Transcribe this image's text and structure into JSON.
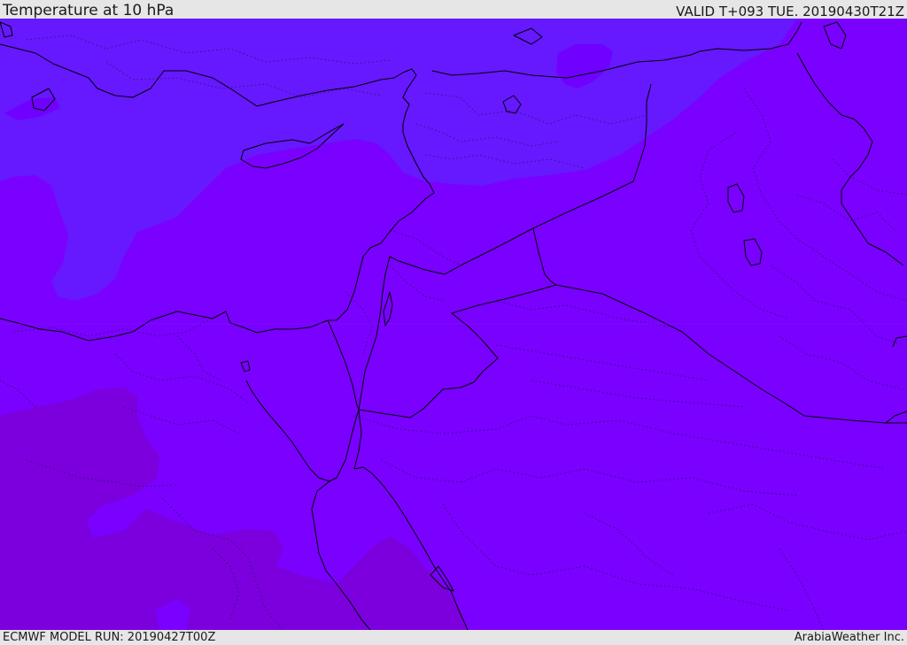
{
  "header": {
    "title": "Temperature at 10 hPa",
    "valid": "VALID T+093 TUE. 20190430T21Z"
  },
  "footer": {
    "model_run": "ECMWF MODEL RUN: 20190427T00Z",
    "credit": "ArabiaWeather Inc."
  },
  "map": {
    "region": "Eastern Mediterranean / Middle East",
    "field": "temperature-10hPa",
    "colors": {
      "cold_band": "#6618ff",
      "mid_band": "#7a00ff",
      "warm_band": "#7b00dd",
      "border_line": "#000000"
    }
  }
}
